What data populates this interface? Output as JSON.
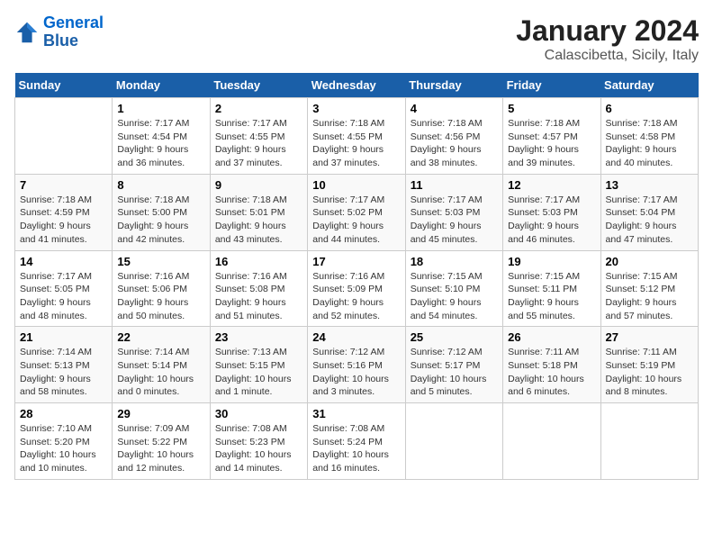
{
  "header": {
    "logo_line1": "General",
    "logo_line2": "Blue",
    "title": "January 2024",
    "subtitle": "Calascibetta, Sicily, Italy"
  },
  "days_of_week": [
    "Sunday",
    "Monday",
    "Tuesday",
    "Wednesday",
    "Thursday",
    "Friday",
    "Saturday"
  ],
  "weeks": [
    [
      {
        "num": "",
        "info": ""
      },
      {
        "num": "1",
        "info": "Sunrise: 7:17 AM\nSunset: 4:54 PM\nDaylight: 9 hours\nand 36 minutes."
      },
      {
        "num": "2",
        "info": "Sunrise: 7:17 AM\nSunset: 4:55 PM\nDaylight: 9 hours\nand 37 minutes."
      },
      {
        "num": "3",
        "info": "Sunrise: 7:18 AM\nSunset: 4:55 PM\nDaylight: 9 hours\nand 37 minutes."
      },
      {
        "num": "4",
        "info": "Sunrise: 7:18 AM\nSunset: 4:56 PM\nDaylight: 9 hours\nand 38 minutes."
      },
      {
        "num": "5",
        "info": "Sunrise: 7:18 AM\nSunset: 4:57 PM\nDaylight: 9 hours\nand 39 minutes."
      },
      {
        "num": "6",
        "info": "Sunrise: 7:18 AM\nSunset: 4:58 PM\nDaylight: 9 hours\nand 40 minutes."
      }
    ],
    [
      {
        "num": "7",
        "info": "Sunrise: 7:18 AM\nSunset: 4:59 PM\nDaylight: 9 hours\nand 41 minutes."
      },
      {
        "num": "8",
        "info": "Sunrise: 7:18 AM\nSunset: 5:00 PM\nDaylight: 9 hours\nand 42 minutes."
      },
      {
        "num": "9",
        "info": "Sunrise: 7:18 AM\nSunset: 5:01 PM\nDaylight: 9 hours\nand 43 minutes."
      },
      {
        "num": "10",
        "info": "Sunrise: 7:17 AM\nSunset: 5:02 PM\nDaylight: 9 hours\nand 44 minutes."
      },
      {
        "num": "11",
        "info": "Sunrise: 7:17 AM\nSunset: 5:03 PM\nDaylight: 9 hours\nand 45 minutes."
      },
      {
        "num": "12",
        "info": "Sunrise: 7:17 AM\nSunset: 5:03 PM\nDaylight: 9 hours\nand 46 minutes."
      },
      {
        "num": "13",
        "info": "Sunrise: 7:17 AM\nSunset: 5:04 PM\nDaylight: 9 hours\nand 47 minutes."
      }
    ],
    [
      {
        "num": "14",
        "info": "Sunrise: 7:17 AM\nSunset: 5:05 PM\nDaylight: 9 hours\nand 48 minutes."
      },
      {
        "num": "15",
        "info": "Sunrise: 7:16 AM\nSunset: 5:06 PM\nDaylight: 9 hours\nand 50 minutes."
      },
      {
        "num": "16",
        "info": "Sunrise: 7:16 AM\nSunset: 5:08 PM\nDaylight: 9 hours\nand 51 minutes."
      },
      {
        "num": "17",
        "info": "Sunrise: 7:16 AM\nSunset: 5:09 PM\nDaylight: 9 hours\nand 52 minutes."
      },
      {
        "num": "18",
        "info": "Sunrise: 7:15 AM\nSunset: 5:10 PM\nDaylight: 9 hours\nand 54 minutes."
      },
      {
        "num": "19",
        "info": "Sunrise: 7:15 AM\nSunset: 5:11 PM\nDaylight: 9 hours\nand 55 minutes."
      },
      {
        "num": "20",
        "info": "Sunrise: 7:15 AM\nSunset: 5:12 PM\nDaylight: 9 hours\nand 57 minutes."
      }
    ],
    [
      {
        "num": "21",
        "info": "Sunrise: 7:14 AM\nSunset: 5:13 PM\nDaylight: 9 hours\nand 58 minutes."
      },
      {
        "num": "22",
        "info": "Sunrise: 7:14 AM\nSunset: 5:14 PM\nDaylight: 10 hours\nand 0 minutes."
      },
      {
        "num": "23",
        "info": "Sunrise: 7:13 AM\nSunset: 5:15 PM\nDaylight: 10 hours\nand 1 minute."
      },
      {
        "num": "24",
        "info": "Sunrise: 7:12 AM\nSunset: 5:16 PM\nDaylight: 10 hours\nand 3 minutes."
      },
      {
        "num": "25",
        "info": "Sunrise: 7:12 AM\nSunset: 5:17 PM\nDaylight: 10 hours\nand 5 minutes."
      },
      {
        "num": "26",
        "info": "Sunrise: 7:11 AM\nSunset: 5:18 PM\nDaylight: 10 hours\nand 6 minutes."
      },
      {
        "num": "27",
        "info": "Sunrise: 7:11 AM\nSunset: 5:19 PM\nDaylight: 10 hours\nand 8 minutes."
      }
    ],
    [
      {
        "num": "28",
        "info": "Sunrise: 7:10 AM\nSunset: 5:20 PM\nDaylight: 10 hours\nand 10 minutes."
      },
      {
        "num": "29",
        "info": "Sunrise: 7:09 AM\nSunset: 5:22 PM\nDaylight: 10 hours\nand 12 minutes."
      },
      {
        "num": "30",
        "info": "Sunrise: 7:08 AM\nSunset: 5:23 PM\nDaylight: 10 hours\nand 14 minutes."
      },
      {
        "num": "31",
        "info": "Sunrise: 7:08 AM\nSunset: 5:24 PM\nDaylight: 10 hours\nand 16 minutes."
      },
      {
        "num": "",
        "info": ""
      },
      {
        "num": "",
        "info": ""
      },
      {
        "num": "",
        "info": ""
      }
    ]
  ]
}
